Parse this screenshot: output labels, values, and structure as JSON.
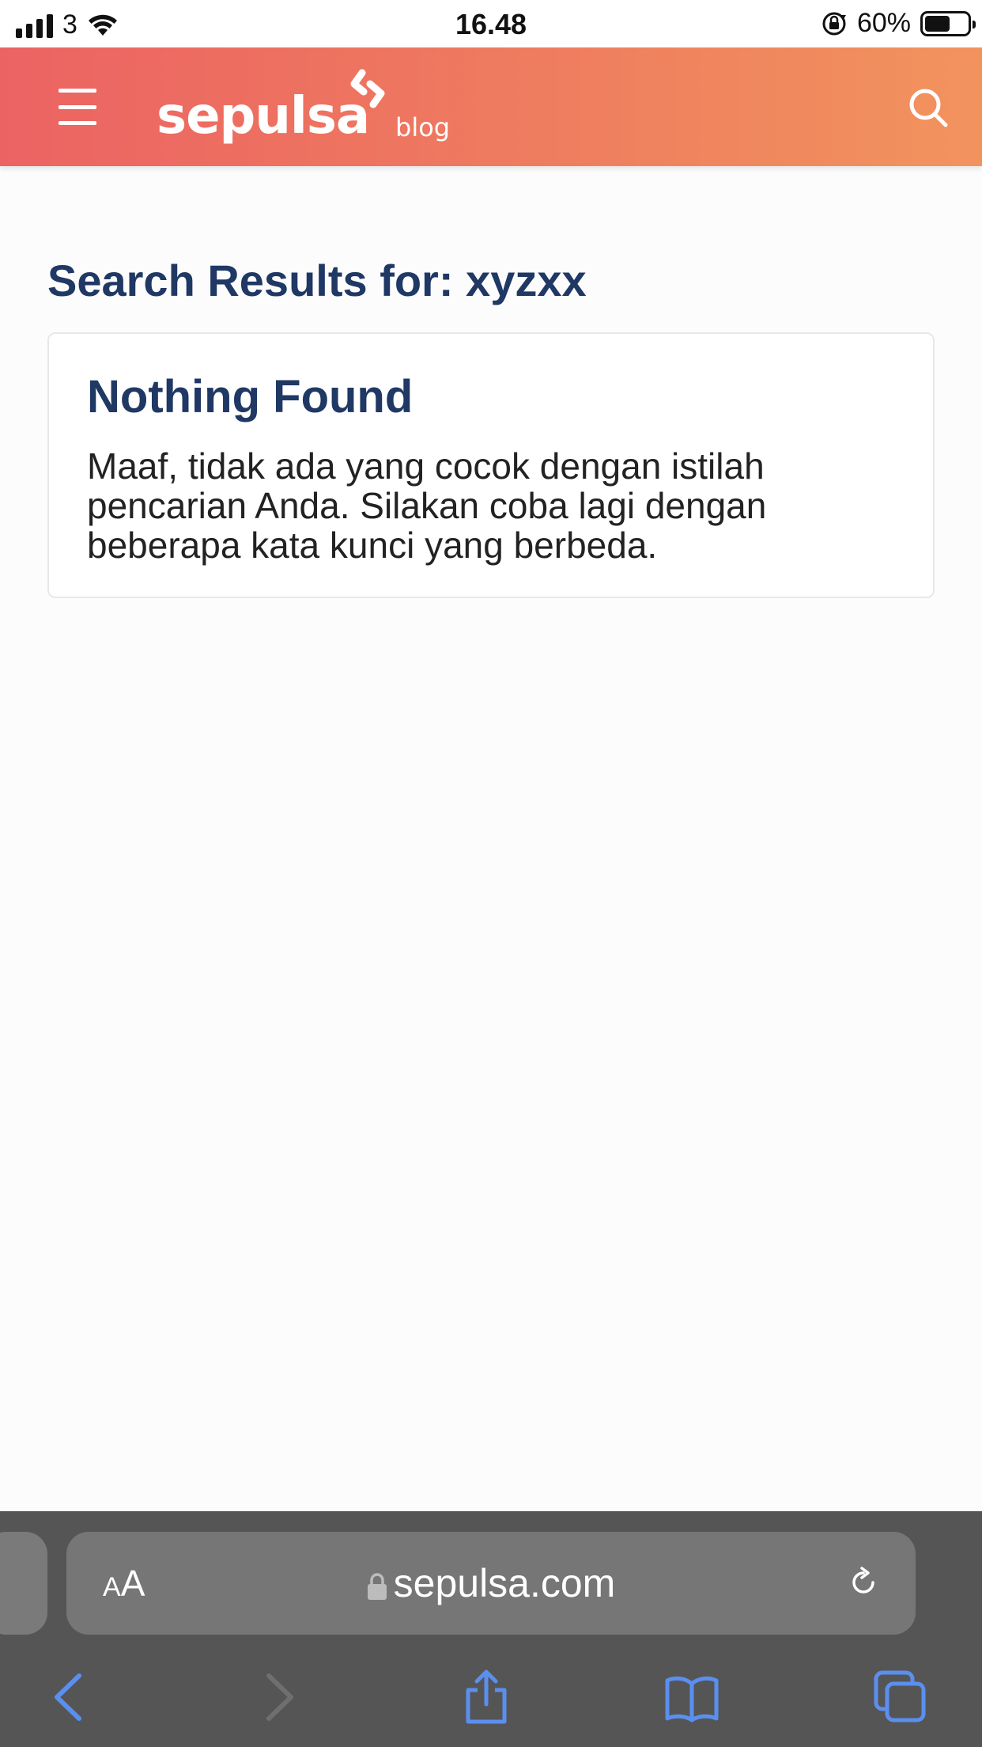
{
  "status_bar": {
    "carrier": "3",
    "time": "16.48",
    "battery_percent": "60%",
    "battery_level": 0.6
  },
  "header": {
    "logo_word": "sepulsa",
    "logo_sub": "blog",
    "menu_icon": "hamburger-icon",
    "search_icon": "search-icon",
    "gradient_start": "#ec6363",
    "gradient_end": "#f2935e"
  },
  "main": {
    "title": "Search Results for: xyzxx",
    "card": {
      "title": "Nothing Found",
      "text": "Maaf, tidak ada yang cocok dengan istilah pencarian Anda. Silakan coba lagi dengan beberapa kata kunci yang berbeda."
    },
    "title_color": "#1f3864"
  },
  "browser": {
    "aa_label_small": "A",
    "aa_label_large": "A",
    "url": "sepulsa.com",
    "accent": "#5b8fef"
  }
}
